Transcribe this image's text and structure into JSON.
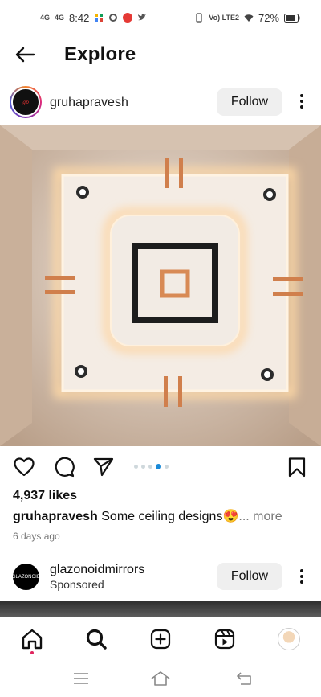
{
  "status_bar": {
    "time": "8:42",
    "network_left": "4G",
    "network_left_2": "4G",
    "volte": "Vo) LTE2",
    "battery": "72%"
  },
  "header": {
    "title": "Explore",
    "back_icon": "arrow-left-icon"
  },
  "post": {
    "username": "gruhapravesh",
    "follow_label": "Follow",
    "likes": "4,937 likes",
    "caption_user": "gruhapravesh",
    "caption_text": " Some ceiling designs😍",
    "caption_more": "... more",
    "timestamp": "6 days ago",
    "carousel": {
      "count": 5,
      "active_index": 3
    },
    "actions": [
      "heart-icon",
      "comment-icon",
      "share-icon",
      "bookmark-icon"
    ]
  },
  "ad": {
    "username": "glazonoidmirrors",
    "sponsored": "Sponsored",
    "follow_label": "Follow",
    "avatar_text": "GLAZONOID"
  },
  "bottom_nav": [
    "home-icon",
    "search-icon",
    "create-icon",
    "reels-icon",
    "profile-avatar"
  ],
  "system_nav": [
    "menu-icon",
    "home-outline-icon",
    "back-icon"
  ],
  "colors": {
    "accent": "#1a8ad8",
    "notification": "#e0245e",
    "follow_bg": "#efefef"
  }
}
